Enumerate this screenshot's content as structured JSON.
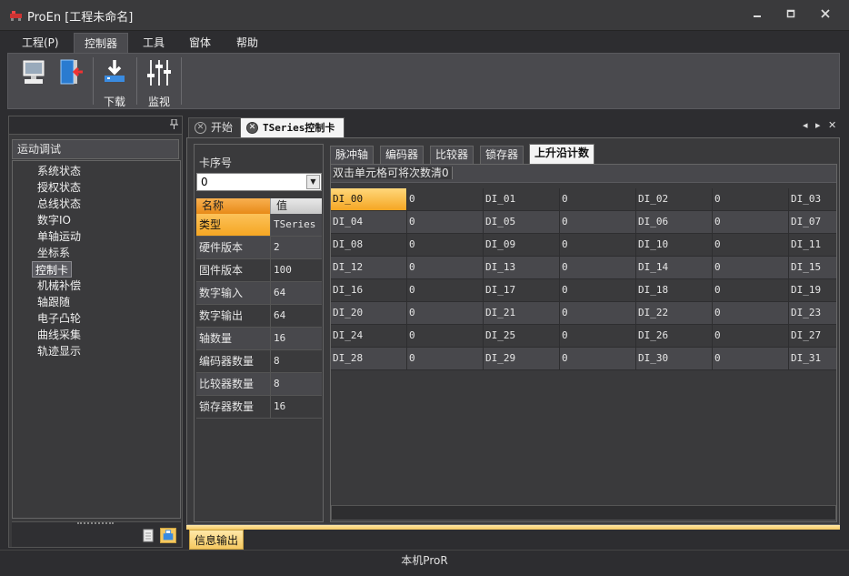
{
  "window": {
    "title": "ProEn [工程未命名]"
  },
  "menu": [
    "工程(P)",
    "控制器",
    "工具",
    "窗体",
    "帮助"
  ],
  "ribbon": {
    "download_label": "下载",
    "monitor_label": "监视"
  },
  "left_panel": {
    "title": "运动调试",
    "items": [
      "系统状态",
      "授权状态",
      "总线状态",
      "数字IO",
      "单轴运动",
      "坐标系",
      "控制卡",
      "机械补偿",
      "轴跟随",
      "电子凸轮",
      "曲线采集",
      "轨迹显示"
    ],
    "selected": "控制卡"
  },
  "doc_tabs": [
    "开始",
    "TSeries控制卡"
  ],
  "card": {
    "label": "卡序号",
    "selected_value": "0",
    "header": {
      "name": "名称",
      "value": "值"
    },
    "rows": [
      {
        "name": "类型",
        "value": "TSeries"
      },
      {
        "name": "硬件版本",
        "value": "2"
      },
      {
        "name": "固件版本",
        "value": "100"
      },
      {
        "name": "数字输入",
        "value": "64"
      },
      {
        "name": "数字输出",
        "value": "64"
      },
      {
        "name": "轴数量",
        "value": "16"
      },
      {
        "name": "编码器数量",
        "value": "8"
      },
      {
        "name": "比较器数量",
        "value": "8"
      },
      {
        "name": "锁存器数量",
        "value": "16"
      }
    ]
  },
  "sub_tabs": [
    "脉冲轴",
    "编码器",
    "比较器",
    "锁存器",
    "上升沿计数"
  ],
  "grid": {
    "hint": "双击单元格可将次数清0",
    "rows": [
      [
        "DI_00",
        "0",
        "DI_01",
        "0",
        "DI_02",
        "0",
        "DI_03"
      ],
      [
        "DI_04",
        "0",
        "DI_05",
        "0",
        "DI_06",
        "0",
        "DI_07"
      ],
      [
        "DI_08",
        "0",
        "DI_09",
        "0",
        "DI_10",
        "0",
        "DI_11"
      ],
      [
        "DI_12",
        "0",
        "DI_13",
        "0",
        "DI_14",
        "0",
        "DI_15"
      ],
      [
        "DI_16",
        "0",
        "DI_17",
        "0",
        "DI_18",
        "0",
        "DI_19"
      ],
      [
        "DI_20",
        "0",
        "DI_21",
        "0",
        "DI_22",
        "0",
        "DI_23"
      ],
      [
        "DI_24",
        "0",
        "DI_25",
        "0",
        "DI_26",
        "0",
        "DI_27"
      ],
      [
        "DI_28",
        "0",
        "DI_29",
        "0",
        "DI_30",
        "0",
        "DI_31"
      ]
    ]
  },
  "bottom_tab": "信息输出",
  "status": "本机ProR",
  "colors": {
    "accent": "#f5a623",
    "background": "#2d2d30",
    "panel": "#3a3a3c"
  }
}
